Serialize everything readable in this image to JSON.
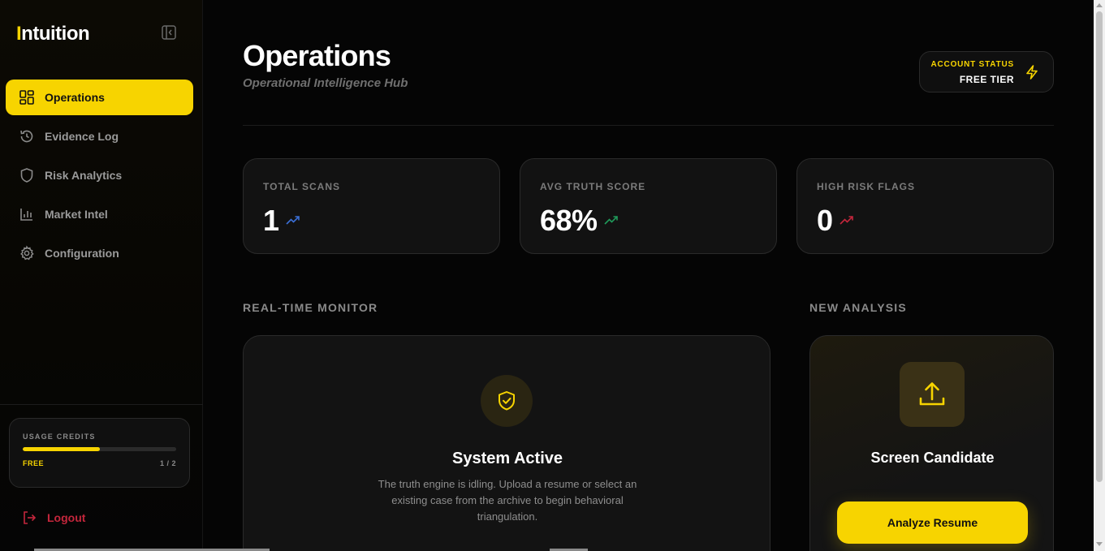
{
  "brand": {
    "first_letter": "I",
    "rest": "ntuition"
  },
  "sidebar": {
    "items": [
      {
        "label": "Operations",
        "icon": "grid-icon",
        "active": true
      },
      {
        "label": "Evidence Log",
        "icon": "history-icon",
        "active": false
      },
      {
        "label": "Risk Analytics",
        "icon": "shield-icon",
        "active": false
      },
      {
        "label": "Market Intel",
        "icon": "bar-chart-icon",
        "active": false
      },
      {
        "label": "Configuration",
        "icon": "gear-icon",
        "active": false
      }
    ],
    "credits": {
      "label": "USAGE CREDITS",
      "tier": "FREE",
      "count": "1 / 2",
      "used": 1,
      "total": 2
    },
    "logout_label": "Logout"
  },
  "header": {
    "title": "Operations",
    "subtitle": "Operational Intelligence Hub",
    "account": {
      "label": "ACCOUNT STATUS",
      "value": "FREE TIER",
      "icon": "bolt-icon"
    }
  },
  "stats": [
    {
      "label": "TOTAL SCANS",
      "value": "1",
      "trend_color": "#3b6fd6"
    },
    {
      "label": "AVG TRUTH SCORE",
      "value": "68%",
      "trend_color": "#1f9a5a"
    },
    {
      "label": "HIGH RISK FLAGS",
      "value": "0",
      "trend_color": "#c4263c"
    }
  ],
  "monitor": {
    "section_label": "REAL-TIME MONITOR",
    "title": "System Active",
    "description": "The truth engine is idling. Upload a resume or select an existing case from the archive to begin behavioral triangulation."
  },
  "analysis": {
    "section_label": "NEW ANALYSIS",
    "title": "Screen Candidate",
    "button_label": "Analyze Resume"
  },
  "colors": {
    "accent": "#f7d400",
    "danger": "#c4263c",
    "background": "#050505"
  }
}
